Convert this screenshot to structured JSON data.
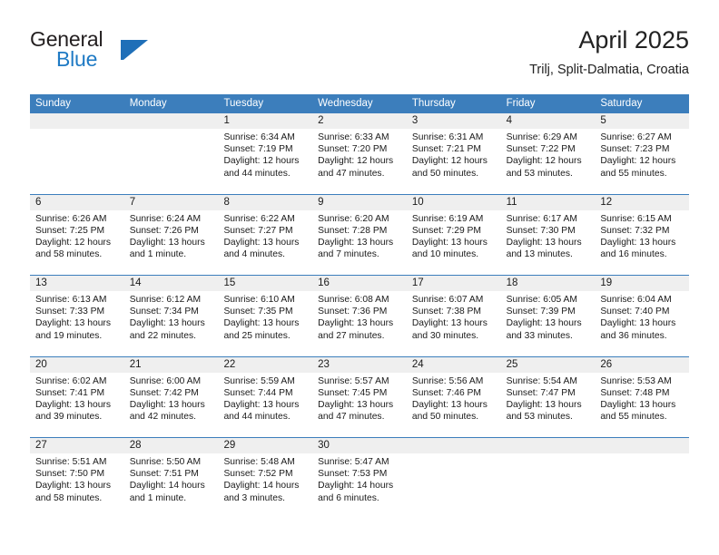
{
  "brand": {
    "word_one": "General",
    "word_two": "Blue",
    "flag_icon": "flag-triangle-icon"
  },
  "header": {
    "title": "April 2025",
    "subtitle": "Trilj, Split-Dalmatia, Croatia"
  },
  "colors": {
    "header_blue": "#3c7ebc",
    "brand_blue": "#1f7ac4",
    "daynum_band": "#efefef",
    "text": "#1a1a1a"
  },
  "calendar": {
    "day_names": [
      "Sunday",
      "Monday",
      "Tuesday",
      "Wednesday",
      "Thursday",
      "Friday",
      "Saturday"
    ],
    "weeks": [
      [
        {
          "day": "",
          "lines": []
        },
        {
          "day": "",
          "lines": []
        },
        {
          "day": "1",
          "lines": [
            "Sunrise: 6:34 AM",
            "Sunset: 7:19 PM",
            "Daylight: 12 hours",
            "and 44 minutes."
          ]
        },
        {
          "day": "2",
          "lines": [
            "Sunrise: 6:33 AM",
            "Sunset: 7:20 PM",
            "Daylight: 12 hours",
            "and 47 minutes."
          ]
        },
        {
          "day": "3",
          "lines": [
            "Sunrise: 6:31 AM",
            "Sunset: 7:21 PM",
            "Daylight: 12 hours",
            "and 50 minutes."
          ]
        },
        {
          "day": "4",
          "lines": [
            "Sunrise: 6:29 AM",
            "Sunset: 7:22 PM",
            "Daylight: 12 hours",
            "and 53 minutes."
          ]
        },
        {
          "day": "5",
          "lines": [
            "Sunrise: 6:27 AM",
            "Sunset: 7:23 PM",
            "Daylight: 12 hours",
            "and 55 minutes."
          ]
        }
      ],
      [
        {
          "day": "6",
          "lines": [
            "Sunrise: 6:26 AM",
            "Sunset: 7:25 PM",
            "Daylight: 12 hours",
            "and 58 minutes."
          ]
        },
        {
          "day": "7",
          "lines": [
            "Sunrise: 6:24 AM",
            "Sunset: 7:26 PM",
            "Daylight: 13 hours",
            "and 1 minute."
          ]
        },
        {
          "day": "8",
          "lines": [
            "Sunrise: 6:22 AM",
            "Sunset: 7:27 PM",
            "Daylight: 13 hours",
            "and 4 minutes."
          ]
        },
        {
          "day": "9",
          "lines": [
            "Sunrise: 6:20 AM",
            "Sunset: 7:28 PM",
            "Daylight: 13 hours",
            "and 7 minutes."
          ]
        },
        {
          "day": "10",
          "lines": [
            "Sunrise: 6:19 AM",
            "Sunset: 7:29 PM",
            "Daylight: 13 hours",
            "and 10 minutes."
          ]
        },
        {
          "day": "11",
          "lines": [
            "Sunrise: 6:17 AM",
            "Sunset: 7:30 PM",
            "Daylight: 13 hours",
            "and 13 minutes."
          ]
        },
        {
          "day": "12",
          "lines": [
            "Sunrise: 6:15 AM",
            "Sunset: 7:32 PM",
            "Daylight: 13 hours",
            "and 16 minutes."
          ]
        }
      ],
      [
        {
          "day": "13",
          "lines": [
            "Sunrise: 6:13 AM",
            "Sunset: 7:33 PM",
            "Daylight: 13 hours",
            "and 19 minutes."
          ]
        },
        {
          "day": "14",
          "lines": [
            "Sunrise: 6:12 AM",
            "Sunset: 7:34 PM",
            "Daylight: 13 hours",
            "and 22 minutes."
          ]
        },
        {
          "day": "15",
          "lines": [
            "Sunrise: 6:10 AM",
            "Sunset: 7:35 PM",
            "Daylight: 13 hours",
            "and 25 minutes."
          ]
        },
        {
          "day": "16",
          "lines": [
            "Sunrise: 6:08 AM",
            "Sunset: 7:36 PM",
            "Daylight: 13 hours",
            "and 27 minutes."
          ]
        },
        {
          "day": "17",
          "lines": [
            "Sunrise: 6:07 AM",
            "Sunset: 7:38 PM",
            "Daylight: 13 hours",
            "and 30 minutes."
          ]
        },
        {
          "day": "18",
          "lines": [
            "Sunrise: 6:05 AM",
            "Sunset: 7:39 PM",
            "Daylight: 13 hours",
            "and 33 minutes."
          ]
        },
        {
          "day": "19",
          "lines": [
            "Sunrise: 6:04 AM",
            "Sunset: 7:40 PM",
            "Daylight: 13 hours",
            "and 36 minutes."
          ]
        }
      ],
      [
        {
          "day": "20",
          "lines": [
            "Sunrise: 6:02 AM",
            "Sunset: 7:41 PM",
            "Daylight: 13 hours",
            "and 39 minutes."
          ]
        },
        {
          "day": "21",
          "lines": [
            "Sunrise: 6:00 AM",
            "Sunset: 7:42 PM",
            "Daylight: 13 hours",
            "and 42 minutes."
          ]
        },
        {
          "day": "22",
          "lines": [
            "Sunrise: 5:59 AM",
            "Sunset: 7:44 PM",
            "Daylight: 13 hours",
            "and 44 minutes."
          ]
        },
        {
          "day": "23",
          "lines": [
            "Sunrise: 5:57 AM",
            "Sunset: 7:45 PM",
            "Daylight: 13 hours",
            "and 47 minutes."
          ]
        },
        {
          "day": "24",
          "lines": [
            "Sunrise: 5:56 AM",
            "Sunset: 7:46 PM",
            "Daylight: 13 hours",
            "and 50 minutes."
          ]
        },
        {
          "day": "25",
          "lines": [
            "Sunrise: 5:54 AM",
            "Sunset: 7:47 PM",
            "Daylight: 13 hours",
            "and 53 minutes."
          ]
        },
        {
          "day": "26",
          "lines": [
            "Sunrise: 5:53 AM",
            "Sunset: 7:48 PM",
            "Daylight: 13 hours",
            "and 55 minutes."
          ]
        }
      ],
      [
        {
          "day": "27",
          "lines": [
            "Sunrise: 5:51 AM",
            "Sunset: 7:50 PM",
            "Daylight: 13 hours",
            "and 58 minutes."
          ]
        },
        {
          "day": "28",
          "lines": [
            "Sunrise: 5:50 AM",
            "Sunset: 7:51 PM",
            "Daylight: 14 hours",
            "and 1 minute."
          ]
        },
        {
          "day": "29",
          "lines": [
            "Sunrise: 5:48 AM",
            "Sunset: 7:52 PM",
            "Daylight: 14 hours",
            "and 3 minutes."
          ]
        },
        {
          "day": "30",
          "lines": [
            "Sunrise: 5:47 AM",
            "Sunset: 7:53 PM",
            "Daylight: 14 hours",
            "and 6 minutes."
          ]
        },
        {
          "day": "",
          "lines": []
        },
        {
          "day": "",
          "lines": []
        },
        {
          "day": "",
          "lines": []
        }
      ]
    ]
  }
}
